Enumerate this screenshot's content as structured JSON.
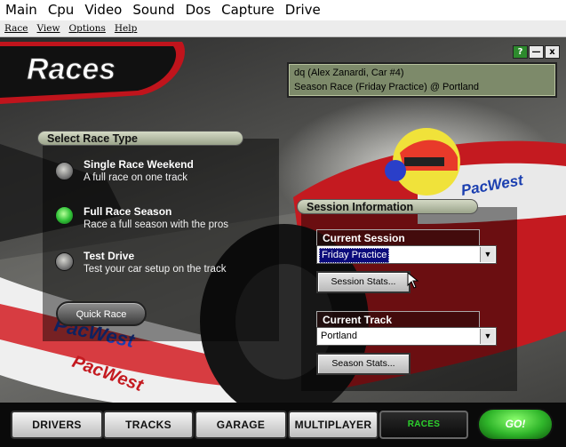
{
  "host_menu": [
    "Main",
    "Cpu",
    "Video",
    "Sound",
    "Dos",
    "Capture",
    "Drive"
  ],
  "app_menu": [
    "Race",
    "View",
    "Options",
    "Help"
  ],
  "window_controls": {
    "help": "?",
    "minimize": "—",
    "close": "x"
  },
  "logo_text": "Races",
  "driver_info": {
    "line1": "dq (Alex Zanardi, Car #4)",
    "line2": "Season Race (Friday Practice) @ Portland"
  },
  "race_type": {
    "header": "Select Race Type",
    "options": [
      {
        "title": "Single Race Weekend",
        "desc": "A full race on one track",
        "selected": false
      },
      {
        "title": "Full Race Season",
        "desc": "Race a full season with the pros",
        "selected": true
      },
      {
        "title": "Test Drive",
        "desc": "Test your car setup on the track",
        "selected": false
      }
    ],
    "quick_race": "Quick Race"
  },
  "session_info": {
    "header": "Session Information",
    "current_session_label": "Current Session",
    "current_session_value": "Friday Practice",
    "session_stats_button": "Session Stats...",
    "current_track_label": "Current Track",
    "current_track_value": "Portland",
    "season_stats_button": "Season Stats..."
  },
  "bottom_tabs": [
    "DRIVERS",
    "TRACKS",
    "GARAGE",
    "MULTIPLAYER",
    "RACES"
  ],
  "active_tab": "RACES",
  "go_button": "GO!",
  "scene_text": {
    "sponsor1": "PacWest",
    "sponsor2": "PacWest",
    "sponsor3": "PacWest"
  },
  "colors": {
    "accent_green": "#2fb52a",
    "info_box": "#7d8a6a",
    "logo_red": "#c0141c"
  }
}
